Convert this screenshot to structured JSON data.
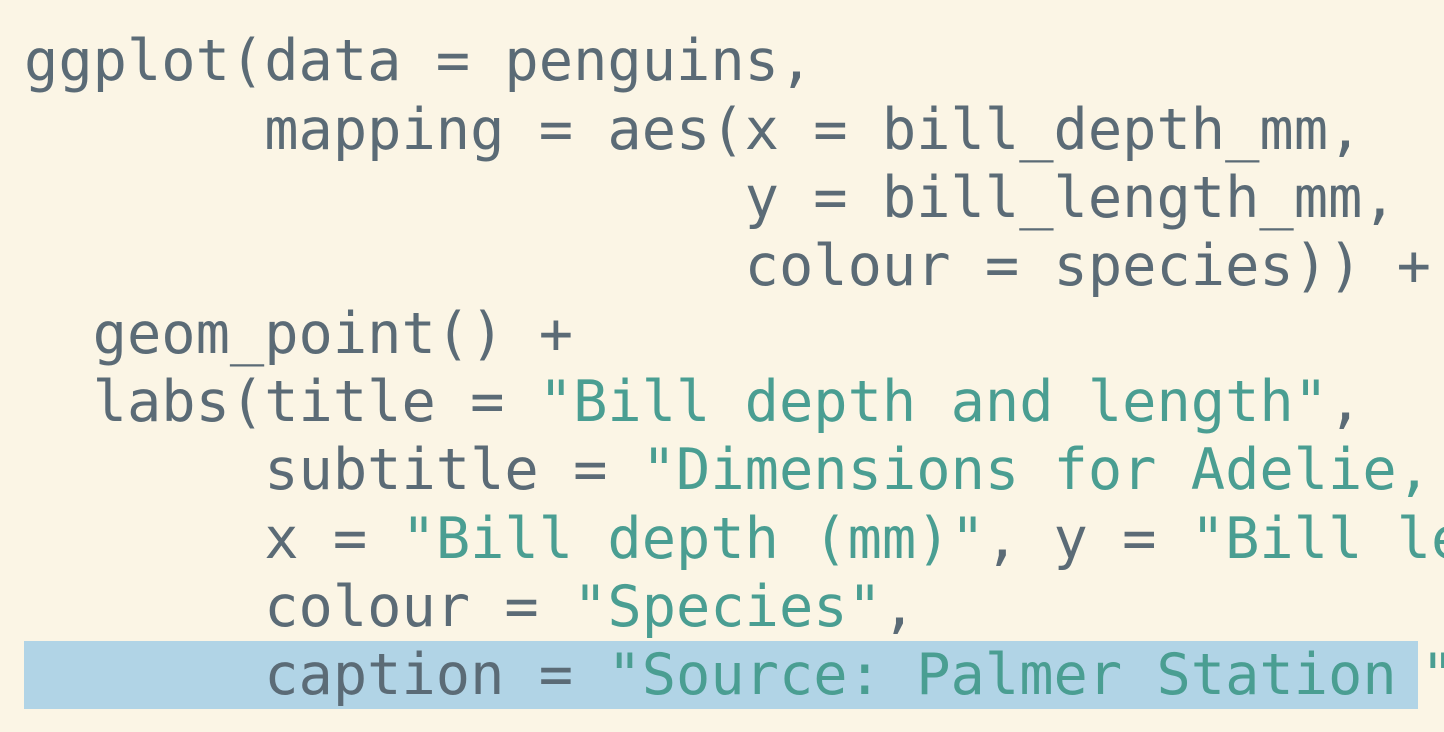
{
  "code": {
    "lines": [
      {
        "indent": "",
        "code": "ggplot(data = penguins,",
        "string": "",
        "rest": ""
      },
      {
        "indent": "       ",
        "code": "mapping = aes(x = bill_depth_mm,",
        "string": "",
        "rest": ""
      },
      {
        "indent": "                     ",
        "code": "y = bill_length_mm,",
        "string": "",
        "rest": ""
      },
      {
        "indent": "                     ",
        "code": "colour = species)) +",
        "string": "",
        "rest": ""
      },
      {
        "indent": "  ",
        "code": "geom_point() +",
        "string": "",
        "rest": ""
      },
      {
        "indent": "  ",
        "code": "labs(title = ",
        "string": "\"Bill depth and length\"",
        "rest": ","
      },
      {
        "indent": "       ",
        "code": "subtitle = ",
        "string": "\"Dimensions for Adelie,",
        "rest": ""
      },
      {
        "indent": "       ",
        "code": "x = ",
        "string": "\"Bill depth (mm)\"",
        "rest": ", y = ",
        "string2": "\"Bill le"
      },
      {
        "indent": "       ",
        "code": "colour = ",
        "string": "\"Species\"",
        "rest": ","
      },
      {
        "indent": "       ",
        "code": "caption = ",
        "string": "\"Source: Palmer Station",
        "rest": "",
        "overflow": "\""
      }
    ]
  },
  "colors": {
    "background": "#fbf5e5",
    "code_text": "#5b6b76",
    "string_text": "#4a9e92",
    "line_highlight": "#b1d4e6"
  }
}
